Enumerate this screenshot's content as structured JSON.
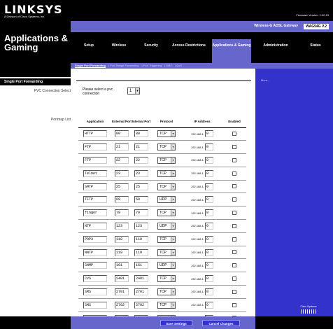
{
  "brand": {
    "logo": "LINKSYS",
    "logo_sub": "A Division of Cisco Systems, Inc.",
    "firmware": "Firmware Version: 1.00.13"
  },
  "section_title": "Applications & Gaming",
  "product": {
    "name": "Wireless-G ADSL Gateway",
    "model": "WAG54G V.2"
  },
  "tabs": [
    {
      "label": "Setup",
      "active": false
    },
    {
      "label": "Wireless",
      "active": false
    },
    {
      "label": "Security",
      "active": false
    },
    {
      "label": "Access Restrictions",
      "active": false
    },
    {
      "label": "Applications & Gaming",
      "active": true
    },
    {
      "label": "Administration",
      "active": false
    },
    {
      "label": "Status",
      "active": false
    }
  ],
  "subtabs": [
    {
      "label": "Single Port Forwarding",
      "active": true
    },
    {
      "label": "Port Range Forwarding",
      "active": false
    },
    {
      "label": "Port Triggering",
      "active": false
    },
    {
      "label": "DMZ",
      "active": false
    },
    {
      "label": "QoS",
      "active": false
    }
  ],
  "left": {
    "heading": "Single Port Forwarding",
    "pvc_label": "PVC Connection Select",
    "portmap_label": "Portmap List"
  },
  "pvc": {
    "prompt": "Please select a pvc connection",
    "selected": "1"
  },
  "table": {
    "headers": [
      "Application",
      "External Port",
      "Internal Port",
      "Protocol",
      "IP Address",
      "Enabled"
    ],
    "ip_prefix": "192.168.1.",
    "rows": [
      {
        "app": "HTTP",
        "ext": "80",
        "int": "80",
        "proto": "TCP",
        "ip": "0"
      },
      {
        "app": "FTP",
        "ext": "21",
        "int": "21",
        "proto": "TCP",
        "ip": "0"
      },
      {
        "app": "FTP",
        "ext": "22",
        "int": "22",
        "proto": "TCP",
        "ip": "0"
      },
      {
        "app": "Telnet",
        "ext": "23",
        "int": "23",
        "proto": "TCP",
        "ip": "0"
      },
      {
        "app": "SMTP",
        "ext": "25",
        "int": "25",
        "proto": "TCP",
        "ip": "0"
      },
      {
        "app": "TFTP",
        "ext": "69",
        "int": "69",
        "proto": "UDP",
        "ip": "0"
      },
      {
        "app": "finger",
        "ext": "79",
        "int": "79",
        "proto": "TCP",
        "ip": "0"
      },
      {
        "app": "NTP",
        "ext": "123",
        "int": "123",
        "proto": "UDP",
        "ip": "0"
      },
      {
        "app": "POP3",
        "ext": "110",
        "int": "110",
        "proto": "TCP",
        "ip": "0"
      },
      {
        "app": "NNTP",
        "ext": "119",
        "int": "119",
        "proto": "TCP",
        "ip": "0"
      },
      {
        "app": "SNMP",
        "ext": "161",
        "int": "161",
        "proto": "UDP",
        "ip": "0"
      },
      {
        "app": "CVS",
        "ext": "2401",
        "int": "2401",
        "proto": "TCP",
        "ip": "0"
      },
      {
        "app": "SMS",
        "ext": "2701",
        "int": "2701",
        "proto": "TCP",
        "ip": "0"
      },
      {
        "app": "SMS",
        "ext": "2702",
        "int": "2702",
        "proto": "TCP",
        "ip": "0"
      },
      {
        "app": "",
        "ext": "",
        "int": "",
        "proto": "TCP",
        "ip": ""
      }
    ]
  },
  "right_panel": {
    "label": "More...",
    "logo_text": "Cisco Systems"
  },
  "buttons": {
    "save": "Save Settings",
    "cancel": "Cancel Changes"
  },
  "colors": {
    "accent": "#6666cc",
    "panel": "#3333cc",
    "bar": "#000000"
  }
}
